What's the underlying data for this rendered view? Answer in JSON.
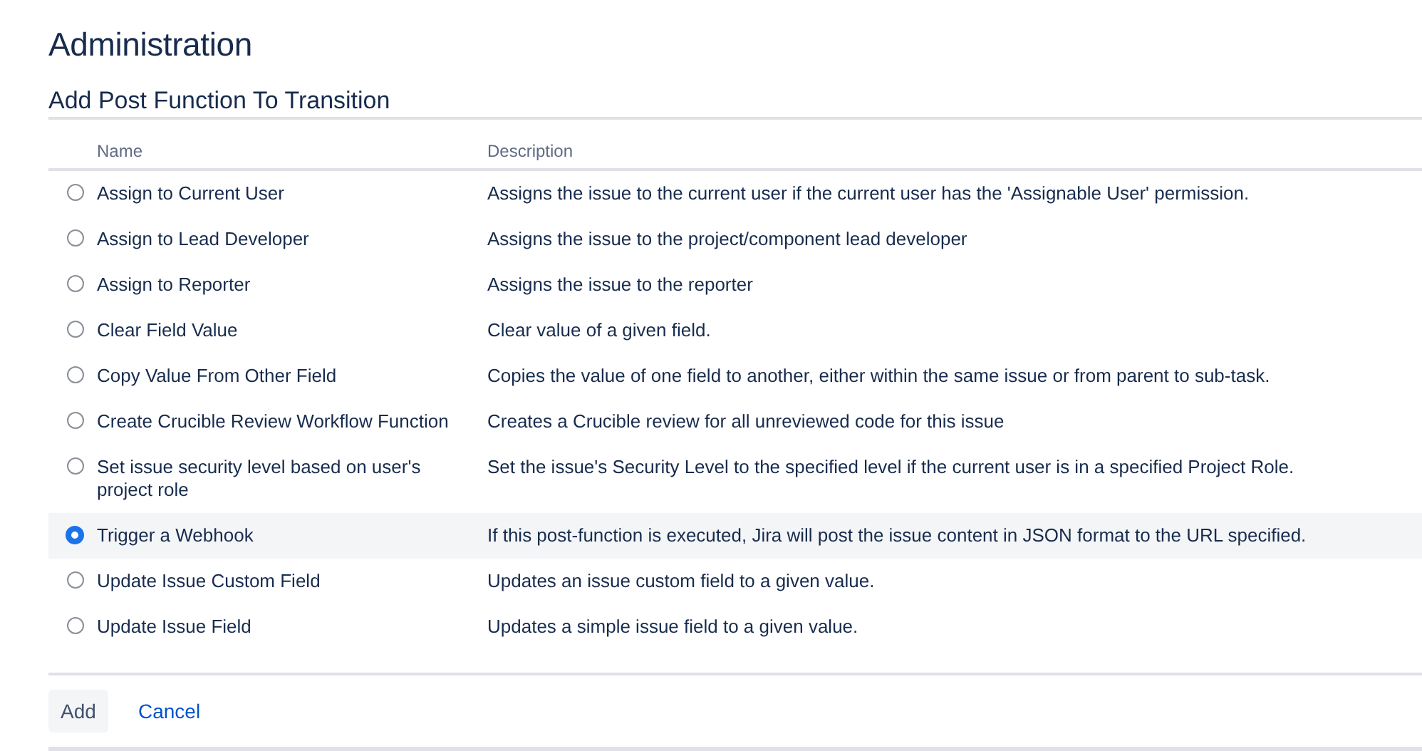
{
  "page_title": "Administration",
  "section_title": "Add Post Function To Transition",
  "table": {
    "columns": [
      "Name",
      "Description"
    ],
    "rows": [
      {
        "name": "Assign to Current User",
        "description": "Assigns the issue to the current user if the current user has the 'Assignable User' permission.",
        "selected": false
      },
      {
        "name": "Assign to Lead Developer",
        "description": "Assigns the issue to the project/component lead developer",
        "selected": false
      },
      {
        "name": "Assign to Reporter",
        "description": "Assigns the issue to the reporter",
        "selected": false
      },
      {
        "name": "Clear Field Value",
        "description": "Clear value of a given field.",
        "selected": false
      },
      {
        "name": "Copy Value From Other Field",
        "description": "Copies the value of one field to another, either within the same issue or from parent to sub-task.",
        "selected": false
      },
      {
        "name": "Create Crucible Review Workflow Function",
        "description": "Creates a Crucible review for all unreviewed code for this issue",
        "selected": false
      },
      {
        "name": "Set issue security level based on user's project role",
        "description": "Set the issue's Security Level to the specified level if the current user is in a specified Project Role.",
        "selected": false
      },
      {
        "name": "Trigger a Webhook",
        "description": "If this post-function is executed, Jira will post the issue content in JSON format to the URL specified.",
        "selected": true
      },
      {
        "name": "Update Issue Custom Field",
        "description": "Updates an issue custom field to a given value.",
        "selected": false
      },
      {
        "name": "Update Issue Field",
        "description": "Updates a simple issue field to a given value.",
        "selected": false
      }
    ]
  },
  "buttons": {
    "add": "Add",
    "cancel": "Cancel"
  }
}
